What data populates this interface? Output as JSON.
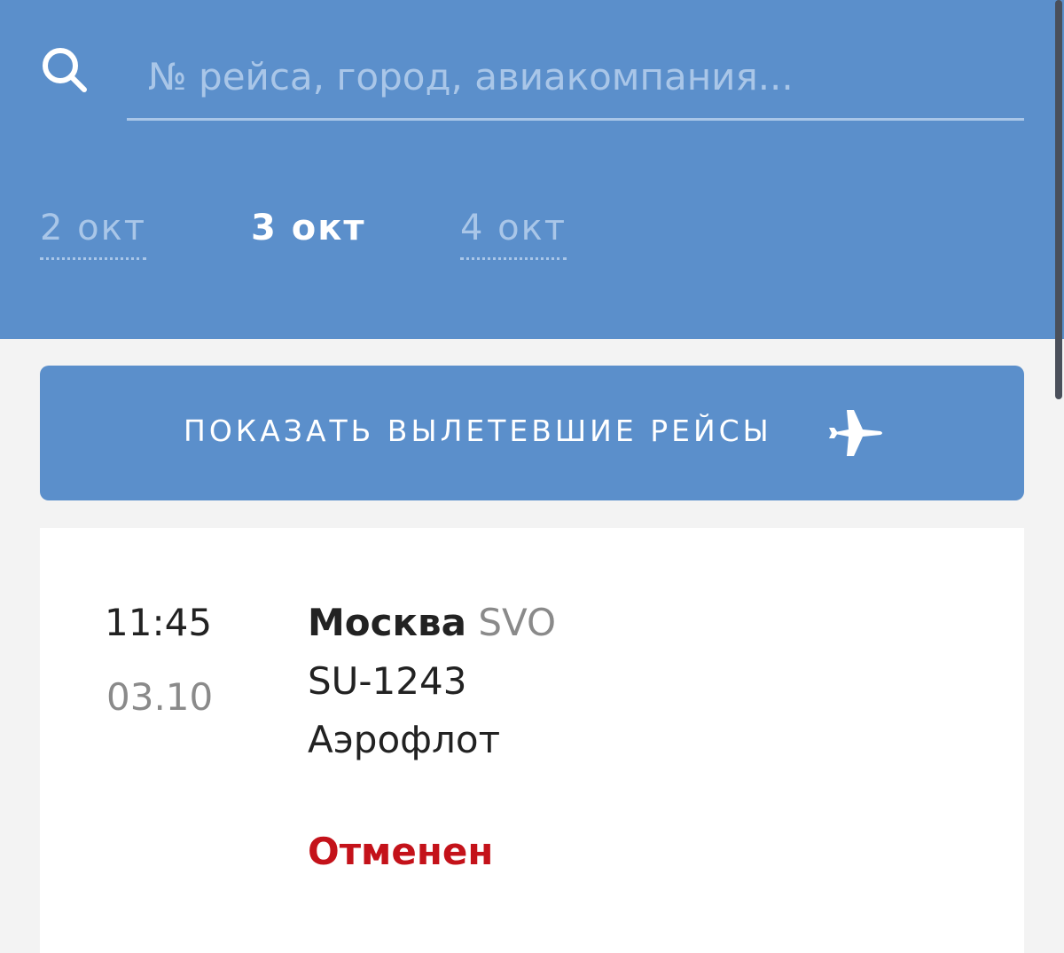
{
  "search": {
    "icon": "search-icon",
    "placeholder": "№ рейса, город, авиакомпания...",
    "value": ""
  },
  "dates": {
    "prev_label": "2 окт",
    "current_label": "3 окт",
    "next_label": "4 окт"
  },
  "show_departed": {
    "label": "ПОКАЗАТЬ ВЫЛЕТЕВШИЕ РЕЙСЫ",
    "icon": "airplane-icon"
  },
  "flight": {
    "time": "11:45",
    "date": "03.10",
    "city": "Москва",
    "airport_code": "SVO",
    "number": "SU-1243",
    "airline": "Аэрофлот",
    "status": "Отменен"
  },
  "colors": {
    "accent": "#5b8fcb",
    "muted_accent": "#a9c6e8",
    "status_cancelled": "#c4121a",
    "background": "#f3f3f3",
    "card": "#ffffff"
  }
}
